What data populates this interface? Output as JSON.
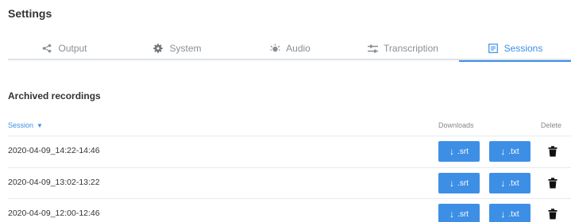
{
  "page": {
    "title": "Settings"
  },
  "tabs": [
    {
      "label": "Output",
      "icon": "share-icon",
      "active": false
    },
    {
      "label": "System",
      "icon": "gear-icon",
      "active": false
    },
    {
      "label": "Audio",
      "icon": "audio-icon",
      "active": false
    },
    {
      "label": "Transcription",
      "icon": "sliders-icon",
      "active": false
    },
    {
      "label": "Sessions",
      "icon": "list-icon",
      "active": true
    }
  ],
  "colors": {
    "accent": "#3d8fe6",
    "text": "#333333",
    "muted": "#8a8f96",
    "divider": "#dce2ea"
  },
  "archive": {
    "title": "Archived recordings",
    "columns": {
      "session": "Session",
      "downloads": "Downloads",
      "delete": "Delete"
    },
    "rows": [
      {
        "session": "2020-04-09_14:22-14:46",
        "srt_label": ".srt",
        "txt_label": ".txt"
      },
      {
        "session": "2020-04-09_13:02-13:22",
        "srt_label": ".srt",
        "txt_label": ".txt"
      },
      {
        "session": "2020-04-09_12:00-12:46",
        "srt_label": ".srt",
        "txt_label": ".txt"
      }
    ]
  }
}
